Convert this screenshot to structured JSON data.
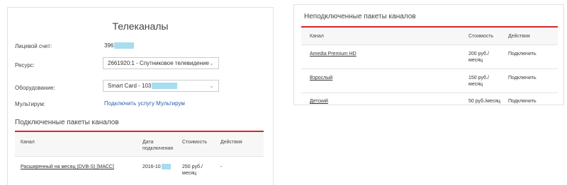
{
  "left": {
    "title": "Телеканалы",
    "fields": {
      "account_label": "Лицевой счет:",
      "account_value": "396",
      "resource_label": "Ресурс:",
      "resource_value": "2661920:1 - Спутниковое телевидение",
      "equipment_label": "Оборудование:",
      "equipment_value": "Smart Card - 103",
      "multiroom_label": "Мультирум:",
      "multiroom_link": "Подключить услугу Мультирум"
    },
    "connected": {
      "title": "Подключенные пакеты каналов",
      "headers": {
        "channel": "Канал",
        "date": "Дата подключения",
        "cost": "Стоимость",
        "actions": "Действия"
      },
      "rows": [
        {
          "channel": "Расширенный на месяц (DVB-S) [МАСС]",
          "date": "2016-10",
          "cost": "250 руб./ месяц",
          "action": "-"
        }
      ]
    }
  },
  "right": {
    "title": "Неподключенные пакеты каналов",
    "headers": {
      "channel": "Канал",
      "cost": "Стоимость",
      "actions": "Действия"
    },
    "rows": [
      {
        "channel": "Amedia Premium HD",
        "cost": "200 руб./ месяц",
        "action": "Подключить"
      },
      {
        "channel": "Взрослый",
        "cost": "150 руб./ месяц",
        "action": "Подключить"
      },
      {
        "channel": "Детский",
        "cost": "50 руб./месяц",
        "action": "Подключить"
      }
    ]
  },
  "colors": {
    "accent_red": "#d9252a",
    "link_blue": "#2a5fa8",
    "mask_blue": "#a8dcef"
  }
}
